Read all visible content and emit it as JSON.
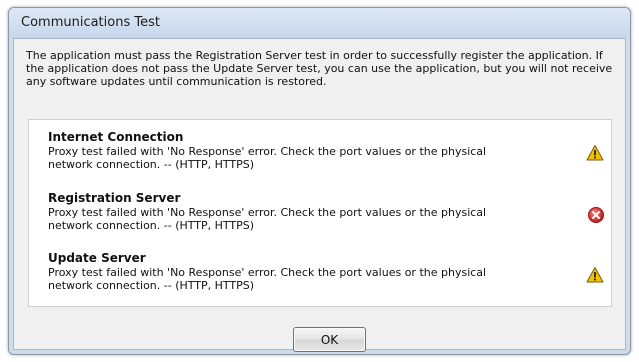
{
  "dialog": {
    "title": "Communications Test",
    "intro": "The application must pass the Registration Server test in order to successfully register the application. If the application does not pass the Update Server test, you can use the application, but you will not receive any software updates until communication is restored."
  },
  "results": [
    {
      "title": "Internet Connection",
      "description": "Proxy test failed with 'No Response' error. Check the port values or the physical network connection. -- (HTTP, HTTPS)",
      "status_icon": "warning-icon"
    },
    {
      "title": "Registration Server",
      "description": "Proxy test failed with 'No Response' error. Check the port values or the physical network connection. -- (HTTP, HTTPS)",
      "status_icon": "error-icon"
    },
    {
      "title": "Update Server",
      "description": "Proxy test failed with 'No Response' error. Check the port values or the physical network connection. -- (HTTP, HTTPS)",
      "status_icon": "warning-icon"
    }
  ],
  "buttons": {
    "ok_label": "OK"
  },
  "colors": {
    "warning": "#f2c200",
    "error": "#d8312f",
    "title_bar": "#c6d7eb"
  }
}
